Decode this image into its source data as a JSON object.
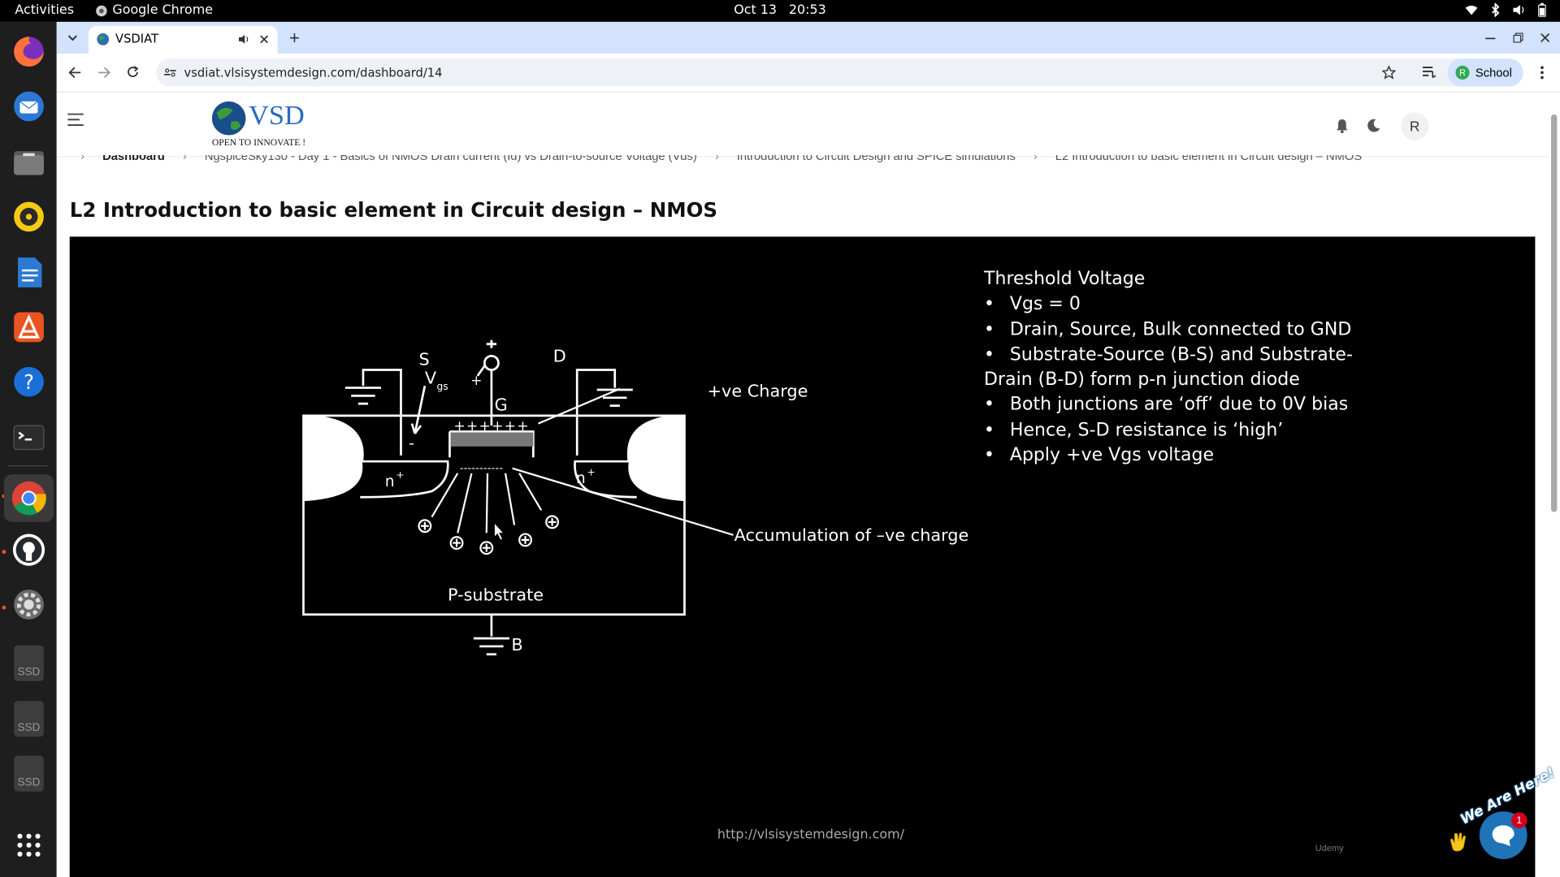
{
  "system": {
    "activities": "Activities",
    "app_name": "Google Chrome",
    "date": "Oct 13",
    "time": "20:53"
  },
  "dock": {
    "apps": [
      "firefox-icon",
      "thunderbird-icon",
      "files-icon",
      "rhythmbox-icon",
      "writer-icon",
      "app-center-icon",
      "help-icon",
      "terminal-icon",
      "chrome-icon",
      "github-desktop-icon",
      "settings-icon",
      "ssd-drive-icon",
      "ssd-drive-icon",
      "ssd-drive-icon",
      "show-apps-icon"
    ],
    "ssd_label": "SSD"
  },
  "browser": {
    "tab_title": "VSDIAT",
    "new_tab": "+",
    "url": "vsdiat.vlsisystemdesign.com/dashboard/14",
    "profile_initial": "R",
    "profile_name": "School"
  },
  "header": {
    "logo_text": "VSD",
    "logo_tagline": "OPEN TO INNOVATE !",
    "avatar_initial": "R"
  },
  "breadcrumb": [
    "Dashboard",
    "NgspiceSky130 - Day 1 - Basics of NMOS Drain current (Id) vs Drain-to-source Voltage (Vds)",
    "Introduction to Circuit Design and SPICE simulations",
    "L2 Introduction to basic element in Circuit design – NMOS"
  ],
  "lesson": {
    "title": "L2 Introduction to basic element in Circuit design – NMOS"
  },
  "slide": {
    "heading": "Threshold Voltage",
    "bullets": [
      "Vgs = 0",
      "Drain, Source, Bulk connected to GND",
      "Substrate-Source (B-S) and Substrate-Drain (B-D) form p-n junction diode",
      "Both junctions are ‘off’ due to 0V bias",
      "Hence, S-D resistance is ‘high’",
      "Apply +ve Vgs voltage"
    ],
    "diagram": {
      "source": "S",
      "drain": "D",
      "gate": "G",
      "bulk": "B",
      "vgs": "V",
      "vgs_sub": "gs",
      "plus": "+",
      "minus": "-",
      "n_plus": "n",
      "sup_plus": "+",
      "gate_charges": "++++++",
      "channel_charges": "-----------",
      "positive_charge": "+ve Charge",
      "accumulation": "Accumulation of –ve charge",
      "substrate": "P-substrate"
    },
    "watermark_url": "http://vlsisystemdesign.com/",
    "udemy": "Udemy"
  },
  "chat": {
    "label": "We Are Here!",
    "badge": "1",
    "close": "×"
  },
  "colors": {
    "accent_tabstrip": "#d3e3fd",
    "topbar": "#000000",
    "dock": "#1e1e1e",
    "chat": "#1f73b7"
  }
}
